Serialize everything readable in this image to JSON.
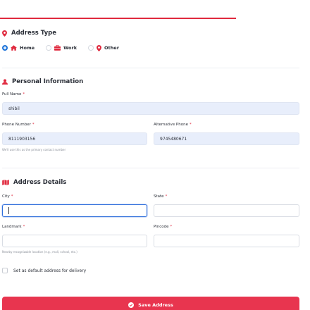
{
  "colors": {
    "accent": "#e02a3f",
    "focus": "#2f6fdb",
    "radio_checked": "#1c73d9",
    "filled_bg": "#e8eefb"
  },
  "address_type": {
    "title": "Address Type",
    "icon": "location-pin-icon",
    "options": [
      {
        "label": "Home",
        "icon": "home-icon",
        "checked": true
      },
      {
        "label": "Work",
        "icon": "briefcase-icon",
        "checked": false
      },
      {
        "label": "Other",
        "icon": "location-pin-icon",
        "checked": false
      }
    ]
  },
  "personal_info": {
    "title": "Personal Information",
    "icon": "user-icon",
    "full_name": {
      "label": "Full Name",
      "required": "*",
      "value": "shibil"
    },
    "phone": {
      "label": "Phone Number",
      "required": "*",
      "value": "8111903156",
      "hint": "We'll use this as the primary contact number"
    },
    "alt_phone": {
      "label": "Alternative Phone",
      "required": "*",
      "value": "9745480671"
    }
  },
  "address_details": {
    "title": "Address Details",
    "icon": "map-icon",
    "city": {
      "label": "City",
      "required": "*",
      "value": ""
    },
    "state": {
      "label": "State",
      "required": "*",
      "value": ""
    },
    "landmark": {
      "label": "Landmark",
      "required": "*",
      "value": "",
      "hint": "Nearby recognizable location (e.g., mall, school, etc.)"
    },
    "pincode": {
      "label": "Pincode",
      "required": "*",
      "value": ""
    }
  },
  "default_checkbox": {
    "label": "Set as default address for delivery",
    "checked": false
  },
  "save_button": {
    "label": "Save Address",
    "icon": "check-circle-icon"
  }
}
